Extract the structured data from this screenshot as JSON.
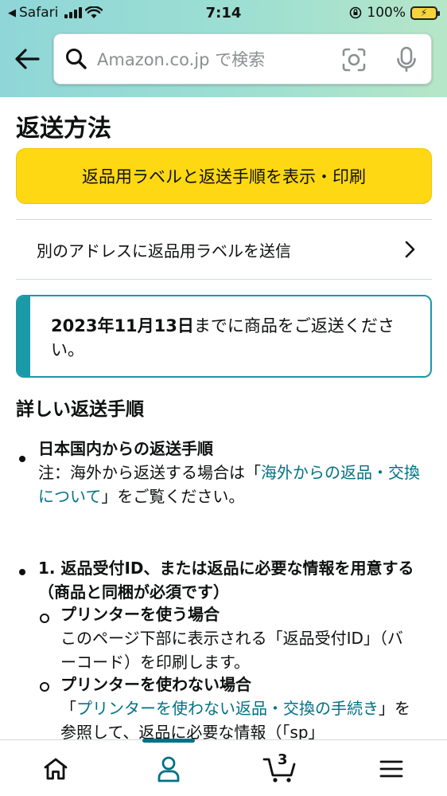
{
  "status_bar": {
    "back_app": "Safari",
    "time": "7:14",
    "battery_percent": "100%"
  },
  "header": {
    "search_placeholder": "Amazon.co.jp で検索"
  },
  "page": {
    "title": "返送方法",
    "primary_button": "返品用ラベルと返送手順を表示・印刷",
    "alt_address_link": "別のアドレスに返品用ラベルを送信",
    "notice_date": "2023年11月13日",
    "notice_rest": "までに商品をご返送ください。",
    "section_title": "詳しい返送手順",
    "domestic_heading": "日本国内からの返送手順",
    "note_prefix": "注：海外から返送する場合は「",
    "note_link": "海外からの返品・交換について",
    "note_suffix": "」をご覧ください。",
    "step1_heading": "1. 返品受付ID、または返品に必要な情報を用意する（商品と同梱が必須です）",
    "printer_heading": "プリンターを使う場合",
    "printer_text": "このページ下部に表示される「返品受付ID」（バーコード）を印刷します。",
    "noprinter_heading": "プリンターを使わない場合",
    "noprinter_prefix": "「",
    "noprinter_link": "プリンターを使わない返品・交換の手続き",
    "noprinter_suffix": "」を参照して、返品に必要な情報（「sp」"
  },
  "bottom_nav": {
    "cart_count": "3"
  },
  "colors": {
    "accent": "#007185",
    "button_yellow": "#ffd814",
    "notice_border": "#1a99a8"
  }
}
